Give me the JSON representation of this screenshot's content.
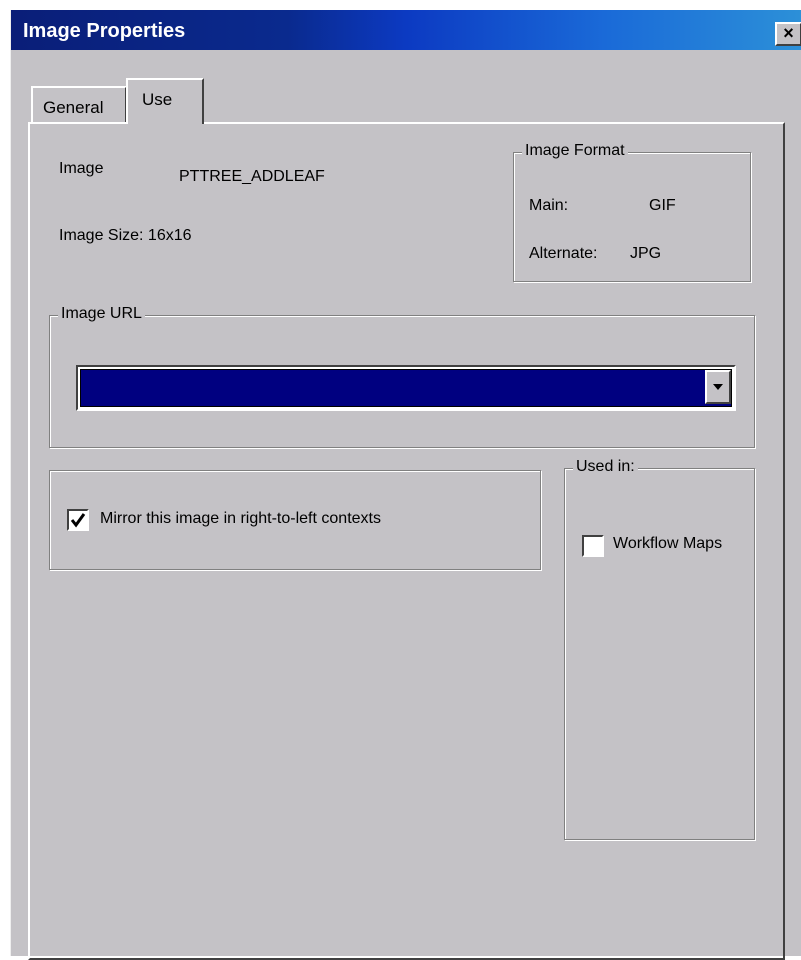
{
  "window": {
    "title": "Image Properties",
    "close_label": "×"
  },
  "tabs": [
    {
      "label": "General",
      "selected": false
    },
    {
      "label": "Use",
      "selected": true
    }
  ],
  "image_info": {
    "image_label": "Image",
    "image_name": "PTTREE_ADDLEAF",
    "size_text": "Image Size: 16x16"
  },
  "image_format": {
    "legend": "Image Format",
    "main_label": "Main:",
    "main_value": "GIF",
    "alternate_label": "Alternate:",
    "alternate_value": "JPG"
  },
  "image_url": {
    "legend": "Image URL",
    "value": "",
    "selection_color": "#000080"
  },
  "mirror": {
    "label": "Mirror this image in right-to-left contexts",
    "checked": true
  },
  "used_in": {
    "legend": "Used in:",
    "items": [
      {
        "label": "Workflow Maps",
        "checked": false
      }
    ]
  },
  "colors": {
    "dialog_bg": "#c4c2c6",
    "title_start": "#0a1e78",
    "title_end": "#2c90d8"
  }
}
